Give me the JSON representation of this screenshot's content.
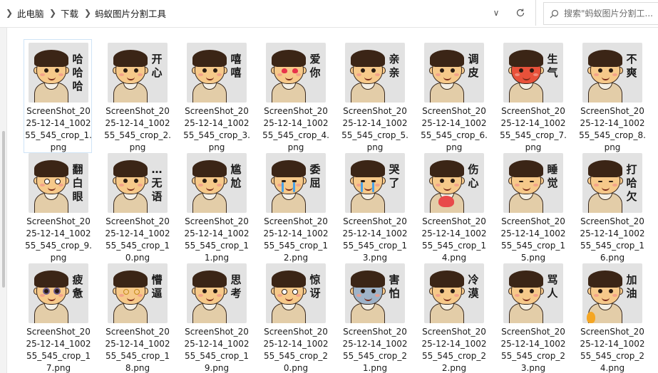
{
  "breadcrumb": [
    {
      "label": "此电脑"
    },
    {
      "label": "下载"
    },
    {
      "label": "蚂蚁图片分割工具"
    }
  ],
  "search": {
    "placeholder": "搜索\"蚂蚁图片分割工..."
  },
  "files": [
    {
      "name": "ScreenShot_2025-12-14_100255_545_crop_1.png",
      "caption": "哈哈哈",
      "variant": "normal",
      "selected": true
    },
    {
      "name": "ScreenShot_2025-12-14_100255_545_crop_2.png",
      "caption": "开心",
      "variant": "normal"
    },
    {
      "name": "ScreenShot_2025-12-14_100255_545_crop_3.png",
      "caption": "嘻嘻",
      "variant": "normal"
    },
    {
      "name": "ScreenShot_2025-12-14_100255_545_crop_4.png",
      "caption": "爱你",
      "variant": "love"
    },
    {
      "name": "ScreenShot_2025-12-14_100255_545_crop_5.png",
      "caption": "亲亲",
      "variant": "normal"
    },
    {
      "name": "ScreenShot_2025-12-14_100255_545_crop_6.png",
      "caption": "调皮",
      "variant": "normal"
    },
    {
      "name": "ScreenShot_2025-12-14_100255_545_crop_7.png",
      "caption": "生气",
      "variant": "red"
    },
    {
      "name": "ScreenShot_2025-12-14_100255_545_crop_8.png",
      "caption": "不爽",
      "variant": "normal"
    },
    {
      "name": "ScreenShot_2025-12-14_100255_545_crop_9.png",
      "caption": "翻白眼",
      "variant": "shock"
    },
    {
      "name": "ScreenShot_2025-12-14_100255_545_crop_10.png",
      "caption": "…无语",
      "variant": "normal"
    },
    {
      "name": "ScreenShot_2025-12-14_100255_545_crop_11.png",
      "caption": "尴尬",
      "variant": "normal"
    },
    {
      "name": "ScreenShot_2025-12-14_100255_545_crop_12.png",
      "caption": "委屈",
      "variant": "cry"
    },
    {
      "name": "ScreenShot_2025-12-14_100255_545_crop_13.png",
      "caption": "哭了",
      "variant": "cry"
    },
    {
      "name": "ScreenShot_2025-12-14_100255_545_crop_14.png",
      "caption": "伤心",
      "variant": "heart"
    },
    {
      "name": "ScreenShot_2025-12-14_100255_545_crop_15.png",
      "caption": "睡觉",
      "variant": "sleep"
    },
    {
      "name": "ScreenShot_2025-12-14_100255_545_crop_16.png",
      "caption": "打哈欠",
      "variant": "sleep"
    },
    {
      "name": "ScreenShot_2025-12-14_100255_545_crop_17.png",
      "caption": "疲惫",
      "variant": "tired"
    },
    {
      "name": "ScreenShot_2025-12-14_100255_545_crop_18.png",
      "caption": "懵逼",
      "variant": "dizzy"
    },
    {
      "name": "ScreenShot_2025-12-14_100255_545_crop_19.png",
      "caption": "思考",
      "variant": "normal"
    },
    {
      "name": "ScreenShot_2025-12-14_100255_545_crop_20.png",
      "caption": "惊讶",
      "variant": "shock"
    },
    {
      "name": "ScreenShot_2025-12-14_100255_545_crop_21.png",
      "caption": "害怕",
      "variant": "blue"
    },
    {
      "name": "ScreenShot_2025-12-14_100255_545_crop_22.png",
      "caption": "冷漠",
      "variant": "normal"
    },
    {
      "name": "ScreenShot_2025-12-14_100255_545_crop_23.png",
      "caption": "骂人",
      "variant": "normal"
    },
    {
      "name": "ScreenShot_2025-12-14_100255_545_crop_24.png",
      "caption": "加油",
      "variant": "fire"
    }
  ],
  "colors": {
    "selection": "#cfe4f7",
    "thumb_bg": "#e2e2e2"
  }
}
